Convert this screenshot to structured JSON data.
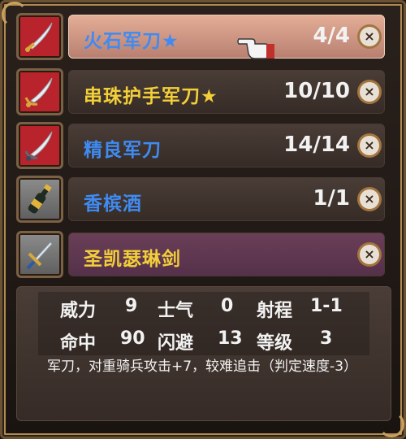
{
  "items": [
    {
      "name": "火石军刀★",
      "uses": "4/4",
      "name_color": "blue",
      "icon": "sword-icon",
      "selected": true
    },
    {
      "name": "串珠护手军刀★",
      "uses": "10/10",
      "name_color": "gold",
      "icon": "sword-icon",
      "selected": false
    },
    {
      "name": "精良军刀",
      "uses": "14/14",
      "name_color": "blue",
      "icon": "sword-icon",
      "selected": false
    },
    {
      "name": "香槟酒",
      "uses": "1/1",
      "name_color": "blue",
      "icon": "bottle-icon",
      "selected": false
    },
    {
      "name": "圣凯瑟琳剑",
      "uses": "",
      "name_color": "gold",
      "icon": "sword-icon",
      "selected": false
    }
  ],
  "discard_glyph": "×",
  "stats": {
    "row1": [
      {
        "label": "威力",
        "value": "9"
      },
      {
        "label": "士气",
        "value": "0"
      },
      {
        "label": "射程",
        "value": "1-1"
      }
    ],
    "row2": [
      {
        "label": "命中",
        "value": "90"
      },
      {
        "label": "闪避",
        "value": "13"
      },
      {
        "label": "等级",
        "value": "3"
      }
    ]
  },
  "description": "军刀，对重骑兵攻击+7，较难追击（判定速度-3）",
  "colors": {
    "blue": "#3f8bf2",
    "gold": "#f2cf3a",
    "selected_bar": "#d59c86",
    "bar": "#3f332e",
    "purple_bar": "#603850"
  }
}
